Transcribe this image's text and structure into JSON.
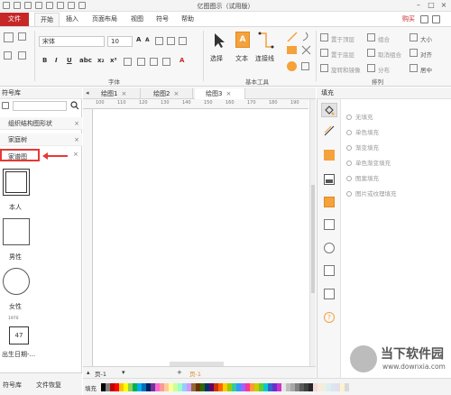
{
  "app": {
    "title": "亿图图示（试用版）",
    "buy_label": "购买"
  },
  "menu": {
    "file": "文件",
    "tabs": [
      "开始",
      "插入",
      "页面布局",
      "视图",
      "符号",
      "帮助"
    ]
  },
  "ribbon": {
    "font_name": "宋体",
    "font_size": "10",
    "group_font": "字体",
    "group_basic_tools": "基本工具",
    "group_arrange": "排列",
    "select_label": "选择",
    "text_label": "文本",
    "connector_label": "连接线",
    "arrange_items": [
      "置于顶层",
      "组合",
      "大小",
      "置于底层",
      "取消组合",
      "对齐",
      "旋转和镜像",
      "分布",
      "居中"
    ]
  },
  "library": {
    "title": "符号库",
    "categories": [
      "组织结构图形状",
      "家庭树",
      "家谱图"
    ],
    "shapes": [
      "本人",
      "男性",
      "女性",
      "出生日期-..."
    ],
    "date_box_value": "47",
    "date_box_year": "1970",
    "bottom_tabs": [
      "符号库",
      "文件恢复"
    ]
  },
  "documents": {
    "tabs": [
      "绘图1",
      "绘图2",
      "绘图3"
    ],
    "active": "绘图3"
  },
  "ruler": {
    "ticks": [
      "100",
      "110",
      "120",
      "130",
      "140",
      "150",
      "160",
      "170",
      "180",
      "190"
    ]
  },
  "pagebar": {
    "page_label": "页-1",
    "page_tab": "页-1"
  },
  "fill_panel": {
    "title": "填充",
    "options": [
      "无填充",
      "单色填充",
      "渐变填充",
      "单色渐变填充",
      "图案填充",
      "图片或纹理填充"
    ]
  },
  "colorbar": {
    "label": "填充",
    "swatches": [
      "#000000",
      "#7f7f7f",
      "#c00000",
      "#ff0000",
      "#ffc000",
      "#ffff00",
      "#92d050",
      "#00b050",
      "#00b0f0",
      "#0070c0",
      "#002060",
      "#7030a0",
      "#ff66cc",
      "#ff9999",
      "#ffcc99",
      "#ffff99",
      "#ccff99",
      "#99ffcc",
      "#99ccff",
      "#cc99ff",
      "#996633",
      "#663300",
      "#336600",
      "#003366",
      "#660066",
      "#cc3300",
      "#ff6600",
      "#ffcc00",
      "#99cc00",
      "#33cc99",
      "#3399ff",
      "#9966ff",
      "#ff3399",
      "#ff9933",
      "#cccc00",
      "#66cc33",
      "#00cccc",
      "#3366cc",
      "#6633cc",
      "#cc33cc",
      "#e6e6e6",
      "#bfbfbf",
      "#a6a6a6",
      "#808080",
      "#595959",
      "#404040",
      "#262626",
      "#f2dcdb",
      "#fde9d9",
      "#ebf1de",
      "#dbeef3",
      "#dce6f1",
      "#e4dfec",
      "#fff2cc",
      "#d9d9d9",
      "#c4bd97",
      "#8db3e2",
      "#b8cce4",
      "#e5b9b7",
      "#d7e3bc",
      "#ccc1d9",
      "#b7dde8",
      "#fbd5b5",
      "#f79646",
      "#4bacc6",
      "#8064a2",
      "#9bbb59",
      "#c0504d",
      "#4f81bd",
      "#1f497d"
    ]
  },
  "watermark": {
    "title": "当下软件园",
    "url": "www.downxia.com"
  },
  "colors": {
    "accent_red": "#c62828",
    "orange": "#f5a13c"
  }
}
